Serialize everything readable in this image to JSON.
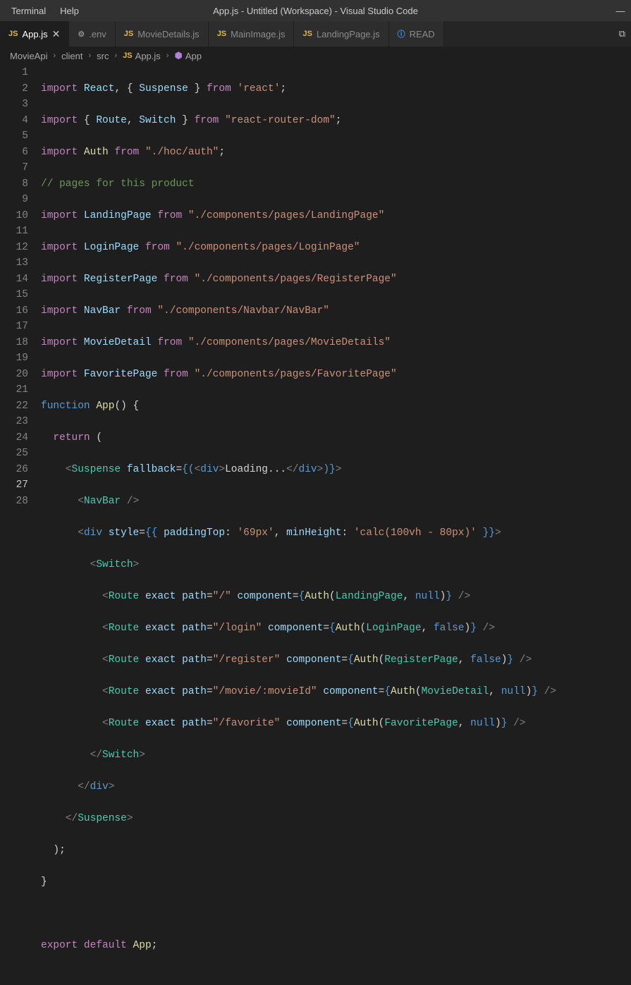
{
  "menubar": {
    "terminal": "Terminal",
    "help": "Help"
  },
  "window_title": "App.js - Untitled (Workspace) - Visual Studio Code",
  "tabs": [
    {
      "icon": "JS",
      "label": "App.js",
      "active": true,
      "close": "✕"
    },
    {
      "icon": "gear",
      "label": ".env"
    },
    {
      "icon": "JS",
      "label": "MovieDetails.js"
    },
    {
      "icon": "JS",
      "label": "MainImage.js"
    },
    {
      "icon": "JS",
      "label": "LandingPage.js"
    },
    {
      "icon": "info",
      "label": "READ"
    }
  ],
  "breadcrumb": {
    "p0": "MovieApi",
    "p1": "client",
    "p2": "src",
    "p3": "App.js",
    "p4": "App"
  },
  "code": {
    "lines": 28,
    "l1": {
      "import": "import",
      "react": "React",
      "comma": ",",
      "lb": "{",
      "suspense": "Suspense",
      "rb": "}",
      "from": "from",
      "str": "'react'",
      "semi": ";"
    },
    "l2": {
      "import": "import",
      "lb": "{",
      "route": "Route",
      "comma": ",",
      "switch": "Switch",
      "rb": "}",
      "from": "from",
      "str": "\"react-router-dom\"",
      "semi": ";"
    },
    "l3": {
      "import": "import",
      "auth": "Auth",
      "from": "from",
      "str": "\"./hoc/auth\"",
      "semi": ";"
    },
    "l4": {
      "comment": "// pages for this product"
    },
    "l5": {
      "import": "import",
      "name": "LandingPage",
      "from": "from",
      "str": "\"./components/pages/LandingPage\""
    },
    "l6": {
      "import": "import",
      "name": "LoginPage",
      "from": "from",
      "str": "\"./components/pages/LoginPage\""
    },
    "l7": {
      "import": "import",
      "name": "RegisterPage",
      "from": "from",
      "str": "\"./components/pages/RegisterPage\""
    },
    "l8": {
      "import": "import",
      "name": "NavBar",
      "from": "from",
      "str": "\"./components/Navbar/NavBar\""
    },
    "l9": {
      "import": "import",
      "name": "MovieDetail",
      "from": "from",
      "str": "\"./components/pages/MovieDetails\""
    },
    "l10": {
      "import": "import",
      "name": "FavoritePage",
      "from": "from",
      "str": "\"./components/pages/FavoritePage\""
    },
    "l11": {
      "function": "function",
      "app": "App",
      "paren": "()",
      "lb": "{"
    },
    "l12": {
      "return": "return",
      "paren": "("
    },
    "l13": {
      "open": "<",
      "tag": "Suspense",
      "attr": "fallback",
      "eq": "=",
      "lb1": "{(",
      "open2": "<",
      "tag2": "div",
      "gt": ">",
      "text": "Loading...",
      "closeopen": "</",
      "tag3": "div",
      "gt2": ">",
      "rb": ")}",
      "gt3": ">"
    },
    "l14": {
      "open": "<",
      "tag": "NavBar",
      "close": "/>"
    },
    "l15": {
      "open": "<",
      "tag": "div",
      "attr": "style",
      "eq": "=",
      "br": "{{",
      "k1": "paddingTop",
      "c": ":",
      "v1": "'69px'",
      "comma": ",",
      "k2": "minHeight",
      "c2": ":",
      "v2": "'calc(100vh - 80px)'",
      "br2": "}}",
      "gt": ">"
    },
    "l16": {
      "open": "<",
      "tag": "Switch",
      "gt": ">"
    },
    "l17": {
      "open": "<",
      "tag": "Route",
      "exact": "exact",
      "path": "path",
      "eq": "=",
      "pathv": "\"/\"",
      "comp": "component",
      "eq2": "=",
      "lb": "{",
      "auth": "Auth",
      "lp": "(",
      "page": "LandingPage",
      "comma": ",",
      "nul": "null",
      "rp": ")",
      "rb": "}",
      "close": "/>"
    },
    "l18": {
      "open": "<",
      "tag": "Route",
      "exact": "exact",
      "path": "path",
      "eq": "=",
      "pathv": "\"/login\"",
      "comp": "component",
      "eq2": "=",
      "lb": "{",
      "auth": "Auth",
      "lp": "(",
      "page": "LoginPage",
      "comma": ",",
      "nul": "false",
      "rp": ")",
      "rb": "}",
      "close": "/>"
    },
    "l19": {
      "open": "<",
      "tag": "Route",
      "exact": "exact",
      "path": "path",
      "eq": "=",
      "pathv": "\"/register\"",
      "comp": "component",
      "eq2": "=",
      "lb": "{",
      "auth": "Auth",
      "lp": "(",
      "page": "RegisterPage",
      "comma": ",",
      "nul": "false",
      "rp": ")",
      "rb": "}",
      "close": "/>"
    },
    "l20": {
      "open": "<",
      "tag": "Route",
      "exact": "exact",
      "path": "path",
      "eq": "=",
      "pathv": "\"/movie/:movieId\"",
      "comp": "component",
      "eq2": "=",
      "lb": "{",
      "auth": "Auth",
      "lp": "(",
      "page": "MovieDetail",
      "comma": ",",
      "nul": "null",
      "rp": ")",
      "rb": "}",
      "close": "/>"
    },
    "l21": {
      "open": "<",
      "tag": "Route",
      "exact": "exact",
      "path": "path",
      "eq": "=",
      "pathv": "\"/favorite\"",
      "comp": "component",
      "eq2": "=",
      "lb": "{",
      "auth": "Auth",
      "lp": "(",
      "page": "FavoritePage",
      "comma": ",",
      "nul": "null",
      "rp": ")",
      "rb": "}",
      "close": "/>"
    },
    "l22": {
      "open": "</",
      "tag": "Switch",
      "gt": ">"
    },
    "l23": {
      "open": "</",
      "tag": "div",
      "gt": ">"
    },
    "l24": {
      "open": "</",
      "tag": "Suspense",
      "gt": ">"
    },
    "l25": {
      "paren": ");"
    },
    "l26": {
      "rb": "}"
    },
    "l28": {
      "export": "export",
      "default": "default",
      "app": "App",
      "semi": ";"
    }
  },
  "line_numbers": [
    "1",
    "2",
    "3",
    "4",
    "5",
    "6",
    "7",
    "8",
    "9",
    "10",
    "11",
    "12",
    "13",
    "14",
    "15",
    "16",
    "17",
    "18",
    "19",
    "20",
    "21",
    "22",
    "23",
    "24",
    "25",
    "26",
    "27",
    "28"
  ]
}
